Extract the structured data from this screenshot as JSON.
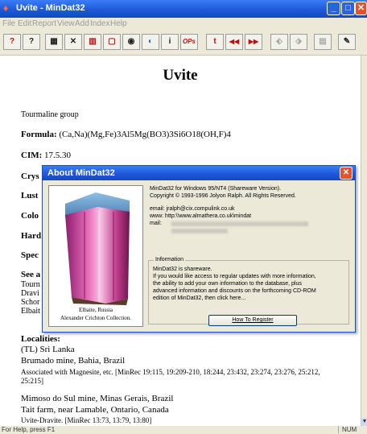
{
  "window": {
    "title": "Uvite - MinDat32",
    "app_icon": "mindat-icon",
    "min_label": "_",
    "max_label": "□",
    "close_label": "✕"
  },
  "menu": [
    "File",
    "Edit",
    "Report",
    "View",
    "Add",
    "Index",
    "Help"
  ],
  "toolbar": [
    {
      "icon": "mineral-help-icon",
      "glyph": "?"
    },
    {
      "icon": "help-icon",
      "glyph": "?"
    },
    {
      "icon": "image-icon",
      "glyph": "▦"
    },
    {
      "icon": "tools-icon",
      "glyph": "✕"
    },
    {
      "icon": "chart-icon",
      "glyph": "▥"
    },
    {
      "icon": "page-icon",
      "glyph": "▢"
    },
    {
      "icon": "mineral-icon",
      "glyph": "◉"
    },
    {
      "icon": "globe-icon",
      "glyph": "◐"
    },
    {
      "icon": "info-icon",
      "glyph": "i"
    },
    {
      "icon": "ops-icon",
      "glyph": "OPs"
    },
    {
      "icon": "tl-icon",
      "glyph": "t"
    },
    {
      "icon": "rewind-icon",
      "glyph": "◀◀"
    },
    {
      "icon": "forward-icon",
      "glyph": "▶▶"
    },
    {
      "icon": "disabled-1-icon",
      "glyph": "⬖"
    },
    {
      "icon": "disabled-2-icon",
      "glyph": "⬗"
    },
    {
      "icon": "disabled-3-icon",
      "glyph": "▤"
    },
    {
      "icon": "edit-icon",
      "glyph": "✎"
    }
  ],
  "doc": {
    "title": "Uvite",
    "group": "Tourmaline group",
    "formula_label": "Formula:",
    "formula": "(Ca,Na)(Mg,Fe)3Al5Mg(BO3)3Si6O18(OH,F)4",
    "cim_label": "CIM:",
    "cim": "17.5.30",
    "partial_labels": [
      "Crys",
      "Lust",
      "Colo",
      "Hard",
      "Spec",
      "See a"
    ],
    "see_also_partial": [
      "Tourn",
      "Dravi",
      "Schor",
      "Elbait"
    ],
    "localities_label": "Localities:",
    "localities": [
      "(TL) Sri Lanka",
      "Brumado mine, Bahia, Brazil",
      "Associated with Magnesite, etc. [MinRec 19:115, 19:209-210, 18:244, 23:432, 23:274, 23:276, 25:212,",
      "25:215]",
      "Mimoso do Sul mine, Minas Gerais, Brazil",
      "Tait farm, near Lamable, Ontario, Canada",
      "Uvite-Dravite. [MinRec 13:73, 13:79, 13:80]"
    ]
  },
  "status": {
    "text": "For Help, press F1",
    "num": "NUM"
  },
  "about": {
    "title": "About MinDat32",
    "close_label": "✕",
    "image_caption_1": "Elbaite, Russia",
    "image_caption_2": "Alexander Crichton Collection.",
    "version": "MinDat32 for Windows 95/NT4 (Shareware Version).",
    "copyright": "Copyright © 1993-1996 Jolyon Ralph. All Rights Reserved.",
    "email": "email: jralph@cix.compulink.co.uk",
    "www": "www: http:\\\\www.almathera.co.uk\\mindat",
    "mail_label": "mail:",
    "info_legend": "Information",
    "info_lines": [
      "MinDat32 is shareware.",
      "If you would like access to regular updates with more information,",
      "the ability to add your own information to the database, plus",
      "advanced information and discounts on the forthcoming CD-ROM",
      "edition of MinDat32, then click here..."
    ],
    "register_label": "How To Register"
  }
}
